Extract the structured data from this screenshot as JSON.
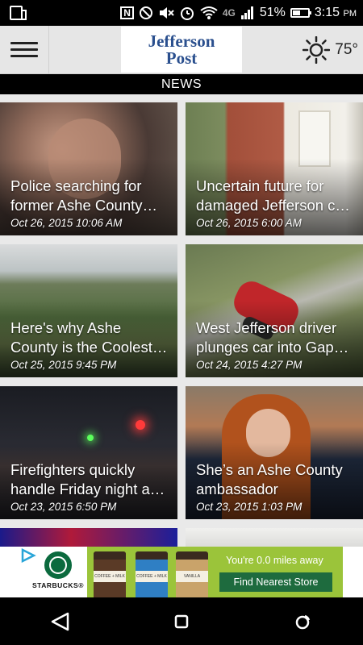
{
  "status_bar": {
    "network": "4G",
    "battery": "51%",
    "battery_level": 0.51,
    "time": "3:15",
    "ampm": "PM"
  },
  "header": {
    "logo_line1": "Jefferson",
    "logo_line2": "Post",
    "temperature": "75°",
    "weather_icon": "sun-icon"
  },
  "section_title": "NEWS",
  "articles": [
    {
      "line1": "Police searching for",
      "line2": "former Ashe County…",
      "date": "Oct 26, 2015 10:06 AM"
    },
    {
      "line1": "Uncertain future for",
      "line2": "damaged Jefferson c…",
      "date": "Oct 26, 2015 6:00 AM"
    },
    {
      "line1": "Here's why Ashe",
      "line2": "County is the Coolest…",
      "date": "Oct 25, 2015 9:45 PM"
    },
    {
      "line1": "West Jefferson driver",
      "line2": "plunges car into Gap…",
      "date": "Oct 24, 2015 4:27 PM"
    },
    {
      "line1": "Firefighters quickly",
      "line2": "handle Friday night a…",
      "date": "Oct 23, 2015 6:50 PM"
    },
    {
      "line1": "She’s an Ashe County",
      "line2": "ambassador",
      "date": "Oct 23, 2015 1:03 PM"
    }
  ],
  "ad": {
    "brand": "STARBUCKS",
    "registered": "®",
    "cup_labels": [
      "COFFEE + MILK",
      "COFFEE + MILK",
      "VANILLA"
    ],
    "distance_text": "You're 0.0 miles away",
    "cta": "Find Nearest Store"
  },
  "colors": {
    "logo_blue": "#2a4f8e",
    "ad_green": "#9bc43a",
    "cta_green": "#1e6b3e"
  }
}
